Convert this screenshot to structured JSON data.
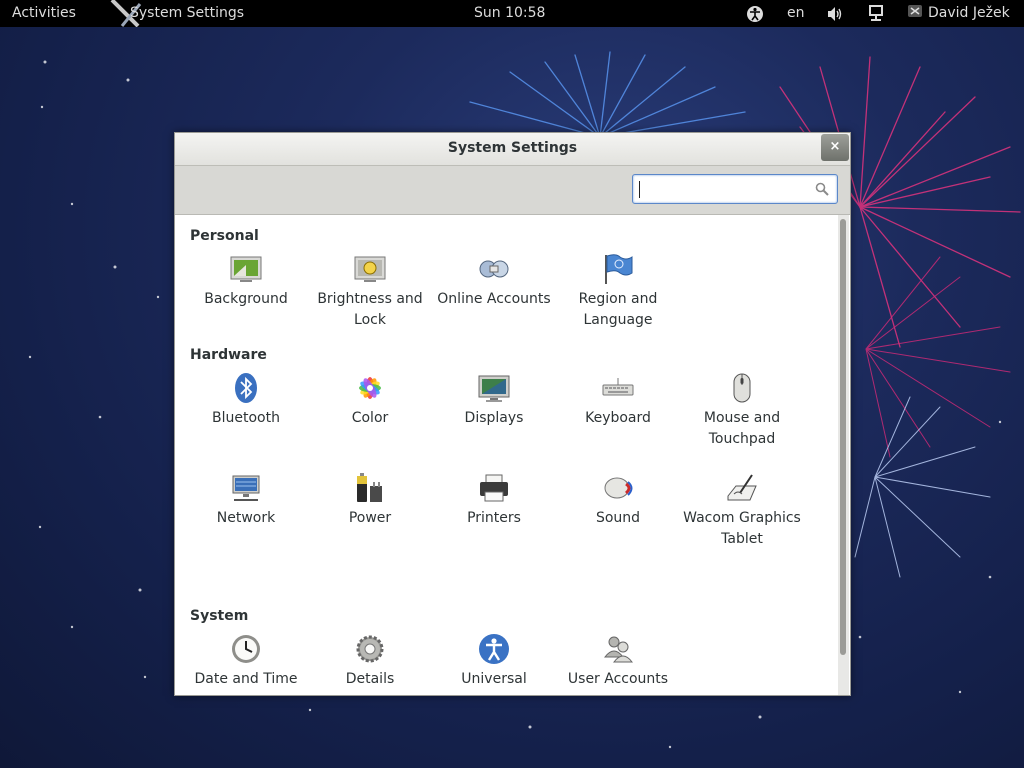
{
  "topbar": {
    "activities": "Activities",
    "app_title": "System Settings",
    "clock": "Sun 10:58",
    "language": "en",
    "user": "David Ježek"
  },
  "window": {
    "title": "System Settings",
    "close": "×",
    "search": {
      "value": "",
      "placeholder": ""
    }
  },
  "sections": {
    "personal": {
      "title": "Personal",
      "items": [
        {
          "label": "Background",
          "icon": "background-icon"
        },
        {
          "label": "Brightness and Lock",
          "icon": "brightness-lock-icon"
        },
        {
          "label": "Online Accounts",
          "icon": "online-accounts-icon"
        },
        {
          "label": "Region and Language",
          "icon": "region-language-icon"
        }
      ]
    },
    "hardware": {
      "title": "Hardware",
      "items": [
        {
          "label": "Bluetooth",
          "icon": "bluetooth-icon"
        },
        {
          "label": "Color",
          "icon": "color-icon"
        },
        {
          "label": "Displays",
          "icon": "displays-icon"
        },
        {
          "label": "Keyboard",
          "icon": "keyboard-icon"
        },
        {
          "label": "Mouse and Touchpad",
          "icon": "mouse-icon"
        },
        {
          "label": "Network",
          "icon": "network-icon"
        },
        {
          "label": "Power",
          "icon": "power-icon"
        },
        {
          "label": "Printers",
          "icon": "printer-icon"
        },
        {
          "label": "Sound",
          "icon": "sound-icon"
        },
        {
          "label": "Wacom Graphics Tablet",
          "icon": "wacom-tablet-icon"
        }
      ]
    },
    "system": {
      "title": "System",
      "items": [
        {
          "label": "Date and Time",
          "icon": "clock-icon"
        },
        {
          "label": "Details",
          "icon": "gear-icon"
        },
        {
          "label": "Universal",
          "icon": "universal-access-icon"
        },
        {
          "label": "User Accounts",
          "icon": "user-accounts-icon"
        }
      ]
    }
  },
  "colors": {
    "topbar_bg": "#000000",
    "accent": "#5b87c9",
    "text": "#2e3436"
  }
}
